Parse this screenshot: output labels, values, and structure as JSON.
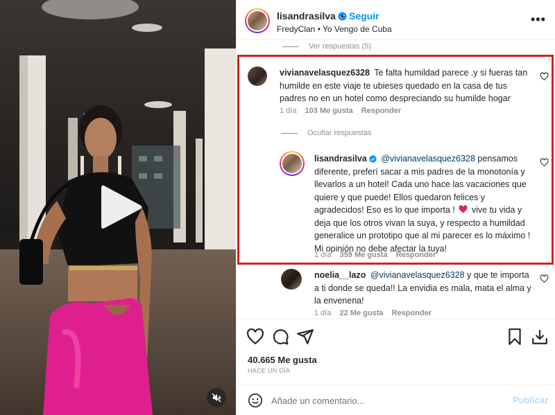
{
  "post": {
    "username": "lisandrasilva",
    "separator": "•",
    "follow_label": "Seguir",
    "subtitle": "FredyClan • Yo Vengo de Cuba",
    "more_label": "•••"
  },
  "comments": {
    "view_replies_label": "Ver respuestas (5)",
    "items": [
      {
        "username": "vivianavelasquez6328",
        "text": "Te falta humildad parece .y si fueras tan humilde en este viaje te ubieses quedado en la casa de tus padres no en un hotel como despreciando su humilde hogar",
        "time": "1 día",
        "likes": "103 Me gusta",
        "reply_label": "Responder",
        "hide_replies_label": "Ocultar respuestas",
        "replies": [
          {
            "username": "lisandrasilva",
            "mention": "@vivianavelasquez6328",
            "text_before_heart": "pensamos diferente, preferí sacar a mis padres de la monotonía y llevarlos a un hotel! Cada uno hace las vacaciones que quiere y que puede! Ellos quedaron felices y agradecidos! Eso es lo que importa !",
            "text_after_heart": "vive tu vida y deja que los otros vivan la suya, y respecto a humildad generalice un prototipo que al mi parecer es lo máximo ! Mi opinión no debe afectar la tuya!",
            "time": "1 día",
            "likes": "359 Me gusta",
            "reply_label": "Responder"
          },
          {
            "username": "noelia__lazo",
            "mention": "@vivianavelasquez6328",
            "text": "y que te importa a ti donde se queda!! La envidia es mala, mata el alma y la envenena!",
            "time": "1 día",
            "likes": "22 Me gusta",
            "reply_label": "Responder"
          }
        ]
      }
    ]
  },
  "footer": {
    "likes_count": "40.665 Me gusta",
    "posted_time": "HACE UN DÍA",
    "comment_placeholder": "Añade un comentario...",
    "publish_label": "Publicar"
  },
  "colors": {
    "link_blue": "#0095f6",
    "mention": "#00376b",
    "highlight_box": "#d61e23",
    "heart_red": "#e0245e"
  },
  "icons": [
    "verified-badge-icon",
    "more-options-icon",
    "heart-icon",
    "comment-icon",
    "share-icon",
    "bookmark-icon",
    "download-icon",
    "emoji-icon",
    "play-icon",
    "muted-icon"
  ]
}
